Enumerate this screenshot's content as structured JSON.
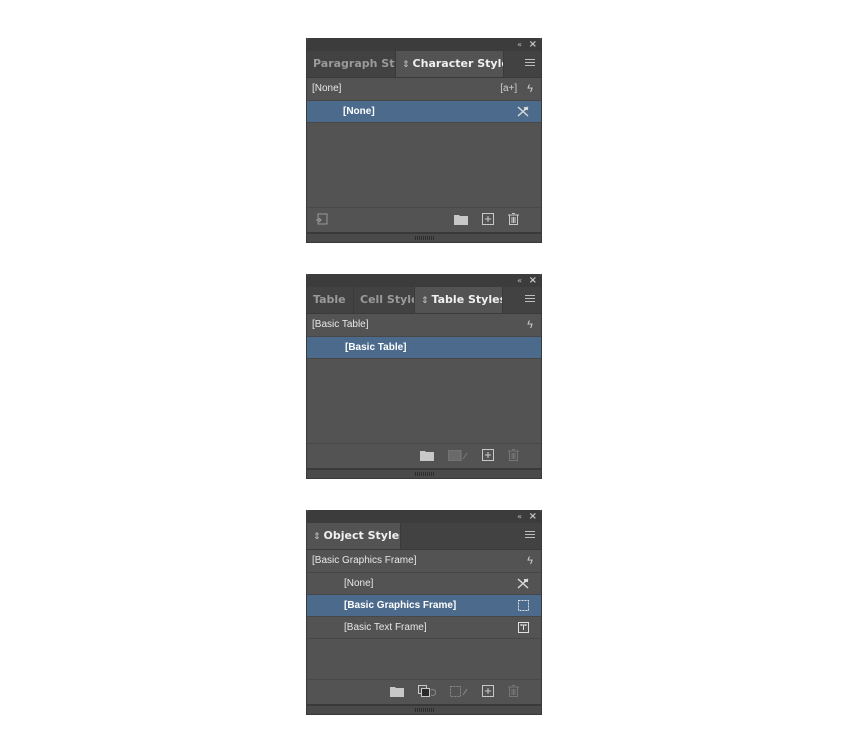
{
  "panels": [
    {
      "name": "character-styles-panel",
      "tabs": [
        {
          "label": "Paragraph Styl",
          "active": false
        },
        {
          "label": "Character Styles",
          "active": true
        }
      ],
      "current_style": "[None]",
      "items": [
        {
          "label": "[None]",
          "selected": true,
          "icon": "no-style-icon"
        }
      ],
      "footer_icons": [
        "load-styles-icon",
        "new-group-folder-icon",
        "new-style-icon",
        "delete-icon"
      ]
    },
    {
      "name": "table-styles-panel",
      "tabs": [
        {
          "label": "Table",
          "active": false
        },
        {
          "label": "Cell Styles",
          "active": false
        },
        {
          "label": "Table Styles",
          "active": true
        }
      ],
      "current_style": "[Basic Table]",
      "items": [
        {
          "label": "[Basic Table]",
          "selected": true,
          "icon": ""
        }
      ],
      "footer_icons": [
        "new-group-folder-icon",
        "clear-overrides-icon",
        "new-style-icon",
        "delete-icon"
      ]
    },
    {
      "name": "object-styles-panel",
      "tabs": [
        {
          "label": "Object Styles",
          "active": true
        }
      ],
      "current_style": "[Basic Graphics Frame]",
      "items": [
        {
          "label": "[None]",
          "selected": false,
          "icon": "no-style-icon"
        },
        {
          "label": "[Basic Graphics Frame]",
          "selected": true,
          "icon": "graphics-frame-icon"
        },
        {
          "label": "[Basic Text Frame]",
          "selected": false,
          "icon": "text-frame-icon"
        }
      ],
      "footer_icons": [
        "new-group-folder-icon",
        "clear-non-defined-attributes-icon",
        "clear-overrides-icon",
        "new-style-icon",
        "delete-icon"
      ]
    }
  ],
  "glyphs": {
    "collapse": "«",
    "close": "×",
    "updown": "⇕",
    "lightning": "ϟ",
    "a_plus": "[a+]"
  },
  "colors": {
    "panel_bg": "#535353",
    "tab_bar_bg": "#424242",
    "selection": "#4b6a8c"
  }
}
